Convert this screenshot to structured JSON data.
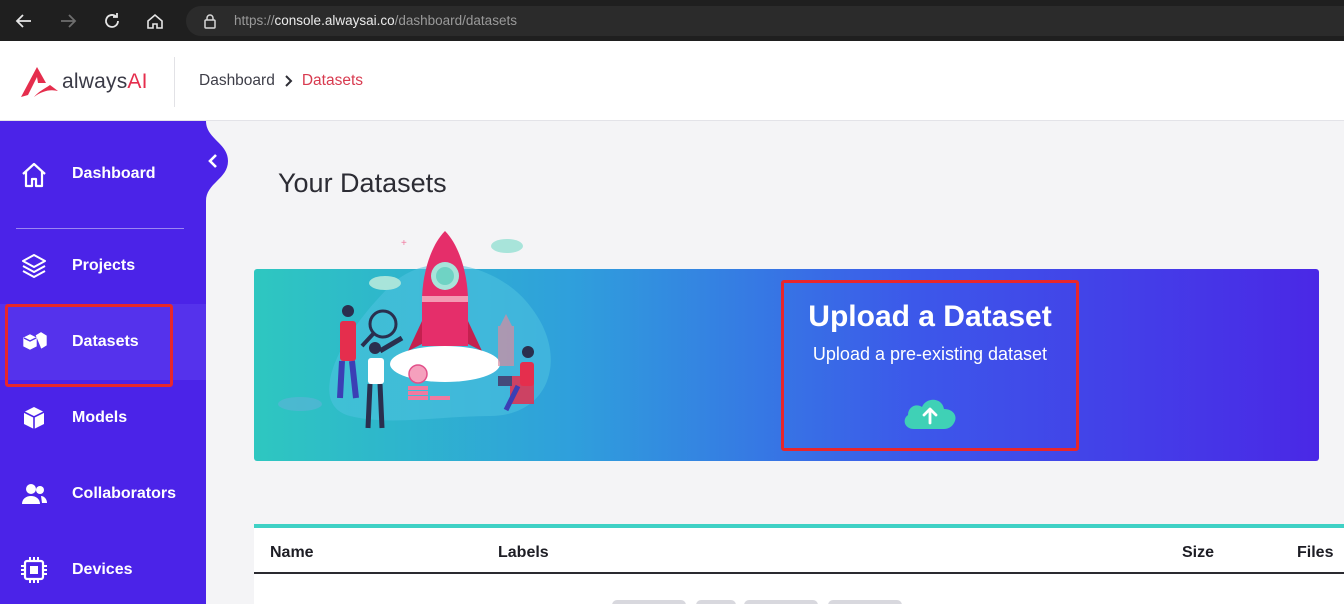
{
  "browser": {
    "url_prefix": "https://",
    "url_host": "console.alwaysai.co",
    "url_path": "/dashboard/datasets",
    "icons": [
      "back-arrow-icon",
      "forward-arrow-icon",
      "reload-icon",
      "home-icon",
      "lock-icon"
    ]
  },
  "header": {
    "logo_always": "always",
    "logo_ai": "AI",
    "breadcrumb": {
      "home": "Dashboard",
      "current": "Datasets"
    }
  },
  "sidebar": {
    "items": [
      {
        "label": "Dashboard",
        "icon": "home-outline-icon"
      },
      {
        "label": "Projects",
        "icon": "layers-icon"
      },
      {
        "label": "Datasets",
        "icon": "cubes-icon"
      },
      {
        "label": "Models",
        "icon": "cube-icon"
      },
      {
        "label": "Collaborators",
        "icon": "people-icon"
      },
      {
        "label": "Devices",
        "icon": "chip-icon"
      }
    ],
    "active": "Datasets"
  },
  "main": {
    "title": "Your Datasets",
    "banner": {
      "title": "Upload a Dataset",
      "subtitle": "Upload a pre-existing dataset"
    },
    "table": {
      "columns": [
        "Name",
        "Labels",
        "Size",
        "Files"
      ]
    }
  },
  "colors": {
    "sidebar": "#4b23e8",
    "accent_red": "#e52e4d",
    "teal": "#3fd1c5",
    "highlight": "#e8262b"
  }
}
